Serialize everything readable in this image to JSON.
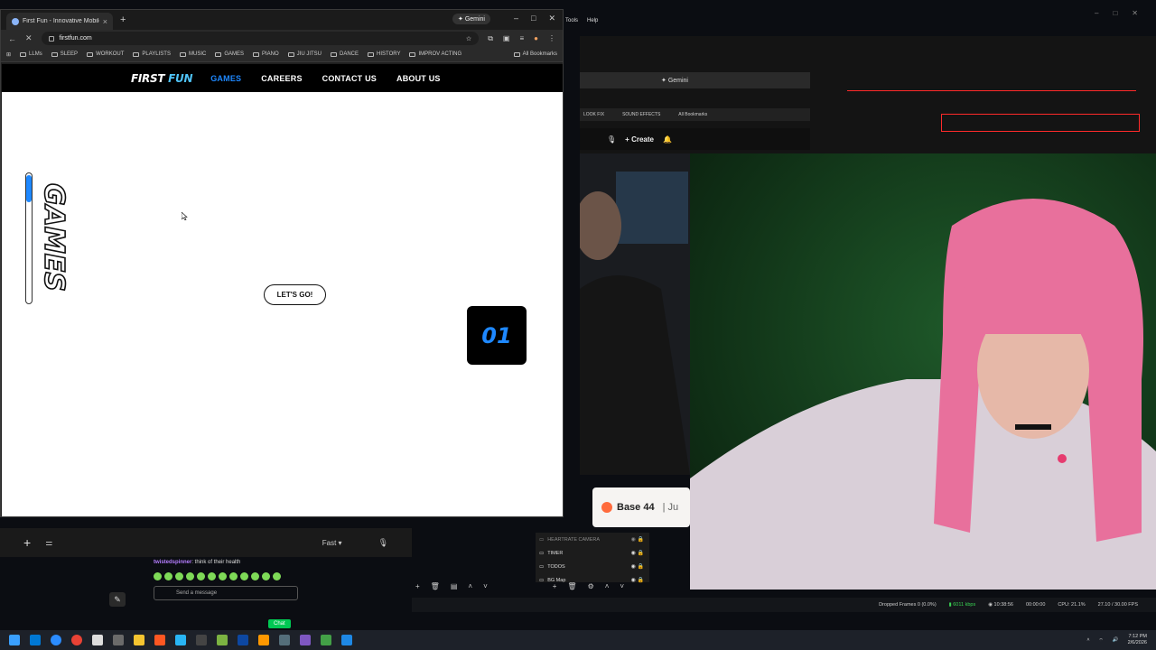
{
  "browser": {
    "tab_title": "First Fun - Innovative Mobile G...",
    "gemini_label": "Gemini",
    "url": "firstfun.com",
    "bookmarks": [
      "LLMs",
      "SLEEP",
      "WORKOUT",
      "PLAYLISTS",
      "MUSIC",
      "GAMES",
      "PIANO",
      "JIU JITSU",
      "DANCE",
      "HISTORY",
      "IMPROV ACTING"
    ],
    "all_bookmarks": "All Bookmarks"
  },
  "site": {
    "logo_first": "FIRST",
    "logo_second": "FUN",
    "nav": [
      "GAMES",
      "CAREERS",
      "CONTACT US",
      "ABOUT US"
    ],
    "side_heading": "GAMES",
    "cta": "LET'S GO!",
    "counter": "01"
  },
  "desktop": {
    "menu": [
      "Tools",
      "Help"
    ],
    "mini_bookmarks": [
      "LOOK FIX",
      "SOUND EFFECTS",
      "All Bookmarks"
    ],
    "mini_gemini": "Gemini",
    "create_label": "Create",
    "base44": {
      "brand": "Base 44",
      "suffix": "Ju"
    }
  },
  "ai_input": {
    "mode": "Fast"
  },
  "chat": {
    "user": "twistedspinner",
    "message": ": think of their health",
    "placeholder": "Send a message",
    "button": "Chat"
  },
  "obs": {
    "sources": [
      {
        "name": "HEARTRATE CAMERA",
        "dim": true
      },
      {
        "name": "TIMER",
        "dim": false
      },
      {
        "name": "TODOS",
        "dim": false
      },
      {
        "name": "BG Map",
        "dim": false
      }
    ],
    "status": {
      "dropped": "Dropped Frames 0 (0.0%)",
      "bitrate": "6011 kbps",
      "time": "10:38:56",
      "rec": "00:00:00",
      "cpu": "CPU: 21.1%",
      "fps": "27.10 / 30.00 FPS"
    }
  },
  "taskbar": {
    "time": "7:12 PM",
    "date": "2/6/2026"
  }
}
